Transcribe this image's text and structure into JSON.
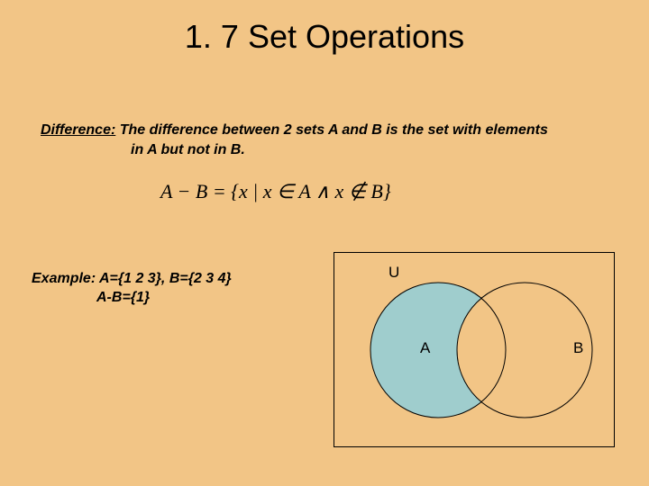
{
  "title": "1. 7 Set Operations",
  "definition": {
    "term": "Difference:",
    "rest": " The difference between 2 sets A and B is the set with elements",
    "line2": "in A but not in B."
  },
  "formula": "A − B = {x | x ∈ A ∧ x ∉ B}",
  "example": {
    "line1": "Example: A={1 2 3}, B={2 3 4}",
    "line2": "A-B={1}"
  },
  "venn": {
    "U": "U",
    "A": "A",
    "B": "B"
  }
}
